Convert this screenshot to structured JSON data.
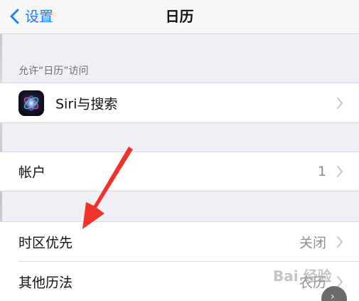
{
  "navbar": {
    "back_label": "设置",
    "title": "日历"
  },
  "section_header": "允许“日历”访问",
  "groups": {
    "access": {
      "rows": [
        {
          "label": "Siri与搜索",
          "icon": "siri-icon"
        }
      ]
    },
    "accounts": {
      "rows": [
        {
          "label": "帐户",
          "value": "1"
        }
      ]
    },
    "options": {
      "rows": [
        {
          "label": "时区优先",
          "value": "关闭"
        },
        {
          "label": "其他历法",
          "value": "农历"
        }
      ]
    }
  },
  "watermark": "Bai 经验",
  "colors": {
    "accent": "#157efb",
    "annotation_arrow": "#f0322c",
    "background": "#efeff4"
  }
}
